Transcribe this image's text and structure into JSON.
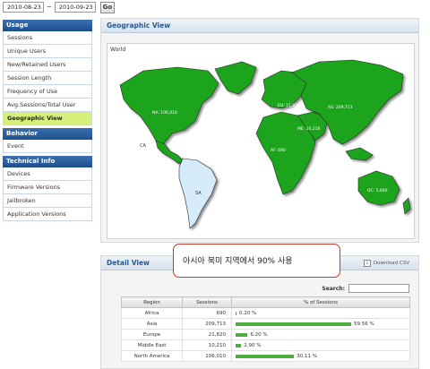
{
  "datebar": {
    "start_date": "2010-08-23",
    "separator": "~",
    "end_date": "2010-09-23",
    "go_label": "Go"
  },
  "sidebar": {
    "sections": [
      {
        "title": "Usage",
        "items": [
          {
            "label": "Sessions",
            "active": false
          },
          {
            "label": "Unique Users",
            "active": false
          },
          {
            "label": "New/Retained Users",
            "active": false
          },
          {
            "label": "Session Length",
            "active": false
          },
          {
            "label": "Frequency of Use",
            "active": false
          },
          {
            "label": "Avg.Sessions/Total User",
            "active": false
          },
          {
            "label": "Geographic View",
            "active": true
          }
        ]
      },
      {
        "title": "Behavior",
        "items": [
          {
            "label": "Event",
            "active": false
          }
        ]
      },
      {
        "title": "Technical Info",
        "items": [
          {
            "label": "Devices",
            "active": false
          },
          {
            "label": "Firmware Versions",
            "active": false
          },
          {
            "label": "Jailbroken",
            "active": false
          },
          {
            "label": "Application Versions",
            "active": false
          }
        ]
      }
    ]
  },
  "geo": {
    "title": "Geographic View",
    "map_label": "World",
    "regions": [
      {
        "name": "North America",
        "label": "NA: 106,010",
        "color": "#1aa51a"
      },
      {
        "name": "Central America",
        "label": "CA",
        "color": "#1aa51a"
      },
      {
        "name": "South America",
        "label": "SA",
        "color": "#d6ecfb"
      },
      {
        "name": "Europe",
        "label": "EU: 21,820",
        "color": "#1aa51a"
      },
      {
        "name": "Middle East",
        "label": "ME: 10,210",
        "color": "#1aa51a"
      },
      {
        "name": "Africa",
        "label": "AF: 690",
        "color": "#1aa51a"
      },
      {
        "name": "Asia",
        "label": "AS: 209,713",
        "color": "#1aa51a"
      },
      {
        "name": "Oceania",
        "label": "OC: 5,660",
        "color": "#1aa51a"
      }
    ]
  },
  "annotation": {
    "text": "아시아 북미 지역에서 90% 사용"
  },
  "detail": {
    "title": "Detail View",
    "csv_label": "Download CSV",
    "search_label": "Search:",
    "search_value": "",
    "columns": [
      "Region",
      "Sessions",
      "% of Sessions"
    ],
    "rows": [
      {
        "region": "Africa",
        "sessions": "690",
        "pct_label": "0.20 %",
        "pct": 0.2
      },
      {
        "region": "Asia",
        "sessions": "209,713",
        "pct_label": "59.56 %",
        "pct": 59.56
      },
      {
        "region": "Europe",
        "sessions": "21,820",
        "pct_label": "6.20 %",
        "pct": 6.2
      },
      {
        "region": "Middle East",
        "sessions": "10,210",
        "pct_label": "2.90 %",
        "pct": 2.9
      },
      {
        "region": "North America",
        "sessions": "106,010",
        "pct_label": "30.11 %",
        "pct": 30.11
      }
    ],
    "bar_color": "#4caf3f"
  }
}
